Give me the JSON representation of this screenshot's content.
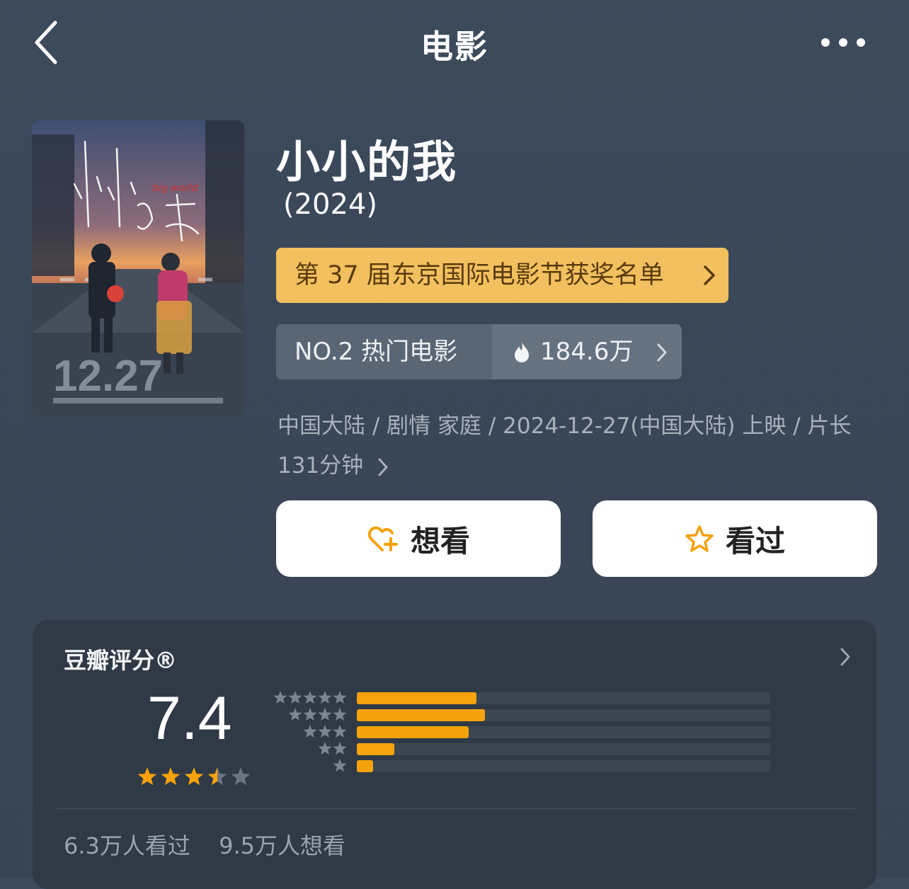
{
  "nav": {
    "title": "电影",
    "back_icon": "back-chevron-icon",
    "more_icon": "more-dots-icon"
  },
  "movie": {
    "title": "小小的我",
    "year": "(2024)",
    "poster_release_text": "12.27"
  },
  "award_banner": {
    "label": "第 37 届东京国际电影节获奖名单"
  },
  "rank": {
    "label": "NO.2 热门电影",
    "heat": "184.6万"
  },
  "meta": {
    "line1": "中国大陆 / 剧情 家庭 / 2024-12-27(中国大陆) 上映 / 片长",
    "line2": "131分钟"
  },
  "actions": {
    "want_label": "想看",
    "seen_label": "看过"
  },
  "rating": {
    "label": "豆瓣评分®",
    "score": "7.4",
    "stars": 3.5,
    "distribution": [
      0.29,
      0.31,
      0.27,
      0.09,
      0.04
    ],
    "seen_count": "6.3万人看过",
    "want_count": "9.5万人想看"
  },
  "colors": {
    "accent_orange": "#f5a20b",
    "award_bg": "#f2c05f",
    "card_bg": "#2f3a46"
  }
}
